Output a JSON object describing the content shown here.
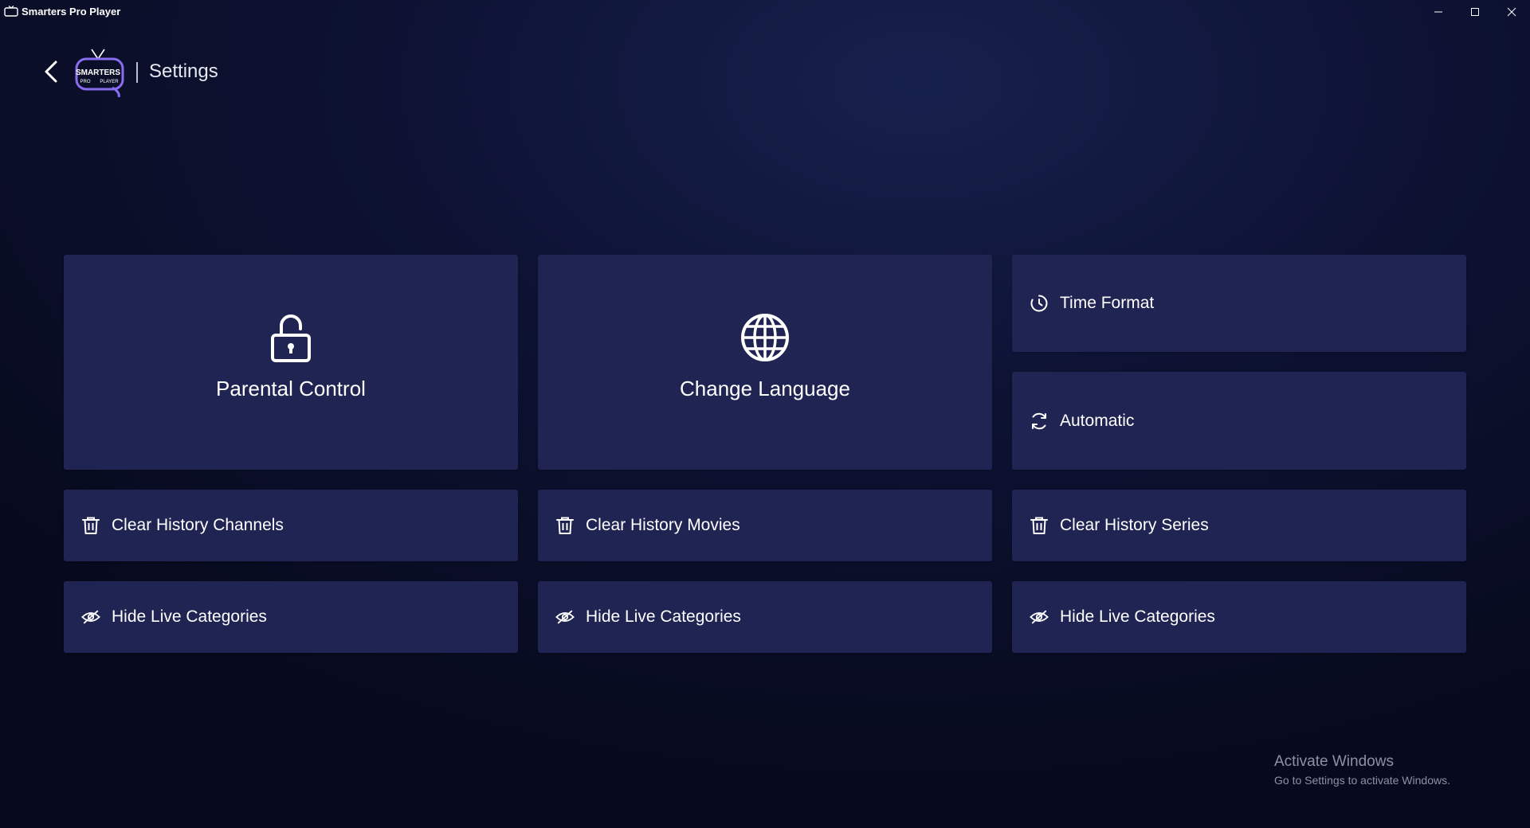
{
  "window": {
    "title": "Smarters Pro Player",
    "controls": [
      "minimize",
      "maximize",
      "close"
    ]
  },
  "header": {
    "page_title": "Settings",
    "logo": {
      "line1": "SMARTERS",
      "line2": "PRO",
      "line3": "PLAYER"
    }
  },
  "cards": {
    "parental_control": {
      "label": "Parental Control",
      "icon": "lock-icon"
    },
    "change_language": {
      "label": "Change Language",
      "icon": "globe-icon"
    },
    "time_format": {
      "label": "Time Format",
      "icon": "clock-icon"
    },
    "automatic": {
      "label": "Automatic",
      "icon": "refresh-icon"
    },
    "clear_history_channels": {
      "label": "Clear History Channels",
      "icon": "trash-icon"
    },
    "clear_history_movies": {
      "label": "Clear History Movies",
      "icon": "trash-icon"
    },
    "clear_history_series": {
      "label": "Clear History Series",
      "icon": "trash-icon"
    },
    "hide_live_categories_1": {
      "label": "Hide Live Categories",
      "icon": "eye-off-icon"
    },
    "hide_live_categories_2": {
      "label": "Hide Live Categories",
      "icon": "eye-off-icon"
    },
    "hide_live_categories_3": {
      "label": "Hide Live Categories",
      "icon": "eye-off-icon"
    }
  },
  "watermark": {
    "title": "Activate Windows",
    "subtitle": "Go to Settings to activate Windows."
  },
  "colors": {
    "card_background": "#1f2452",
    "page_background": "#0d1233",
    "logo_accent": "#8a6cf0"
  }
}
